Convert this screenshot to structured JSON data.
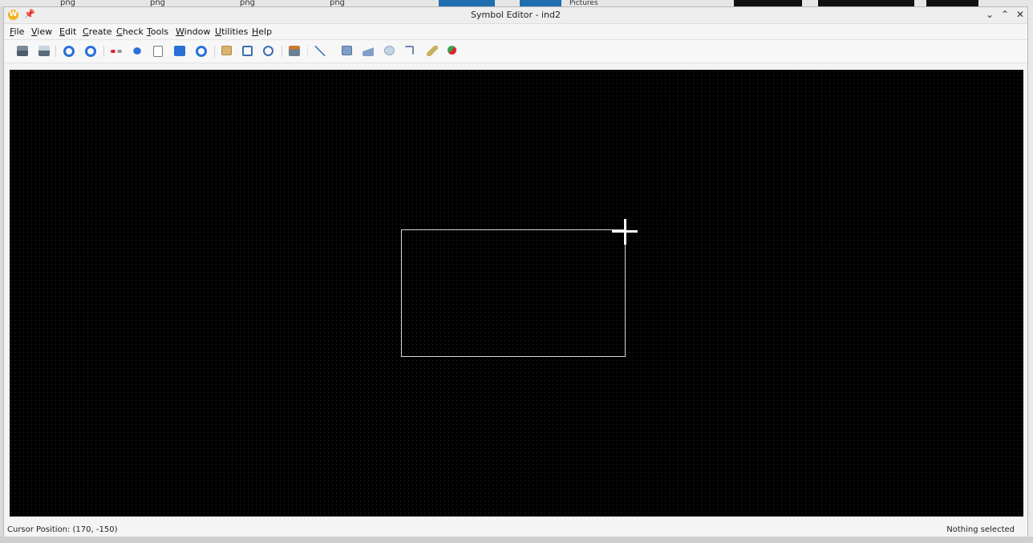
{
  "background": {
    "thumb_labels": [
      "png",
      "png",
      "png",
      "png"
    ],
    "folder_label": "Pictures"
  },
  "window": {
    "title": "Symbol Editor - ind2",
    "app_icon_glyph": "W",
    "pin_glyph": "📌",
    "controls": {
      "minimize": "⌄",
      "maximize": "⌃",
      "close": "✕"
    }
  },
  "menubar": {
    "items": [
      {
        "mnemonic": "F",
        "rest": "ile"
      },
      {
        "mnemonic": "V",
        "rest": "iew"
      },
      {
        "mnemonic": "E",
        "rest": "dit"
      },
      {
        "mnemonic": "C",
        "rest": "reate"
      },
      {
        "mnemonic": "C",
        "rest": "heck"
      },
      {
        "mnemonic": "T",
        "rest": "ools"
      },
      {
        "mnemonic": "W",
        "rest": "indow"
      },
      {
        "mnemonic": "U",
        "rest": "tilities"
      },
      {
        "mnemonic": "H",
        "rest": "elp"
      }
    ]
  },
  "toolbar": {
    "icons": [
      "print-icon",
      "print-preview-icon",
      "undo-icon",
      "redo-icon",
      "pin-arrange-icon",
      "move-icon",
      "copy-icon",
      "stretch-icon",
      "rotate-icon",
      "property-icon",
      "zoom-fit-icon",
      "pan-icon",
      "symbol-icon",
      "line-icon",
      "rectangle-icon",
      "polygon-icon",
      "circle-icon",
      "polyline-icon",
      "pen-icon",
      "pin-add-icon"
    ]
  },
  "colors": {
    "canvas_bg": "#000000",
    "grid_dot": "#2d2d2d",
    "shape_stroke": "#d8d8d8",
    "accent_blue": "#2a6fd6"
  },
  "status": {
    "cursor_position": "Cursor Position: (170, -150)",
    "selection": "Nothing selected"
  }
}
